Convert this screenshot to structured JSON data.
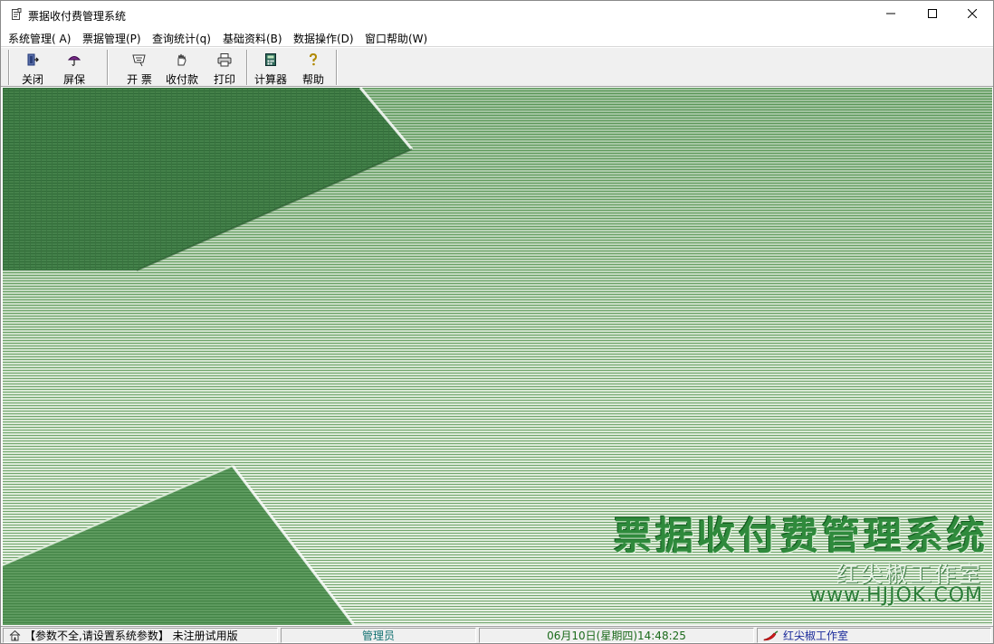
{
  "window": {
    "title": "票据收付费管理系统",
    "icons": {
      "app": "document-icon",
      "minimize": "minimize-icon",
      "maximize": "maximize-icon",
      "close": "close-icon"
    }
  },
  "menu": [
    {
      "label": "系统管理( A)"
    },
    {
      "label": "票据管理(P)"
    },
    {
      "label": "查询统计(q)"
    },
    {
      "label": "基础资料(B)"
    },
    {
      "label": "数据操作(D)"
    },
    {
      "label": "窗口帮助(W)"
    }
  ],
  "toolbar": {
    "close": {
      "label": "关闭",
      "icon": "exit-door-icon"
    },
    "screensaver": {
      "label": "屏保",
      "icon": "umbrella-icon"
    },
    "issue": {
      "label": "开 票",
      "icon": "invoice-icon"
    },
    "payment": {
      "label": "收付款",
      "icon": "hand-money-icon"
    },
    "print": {
      "label": "打印",
      "icon": "printer-icon"
    },
    "calculator": {
      "label": "计算器",
      "icon": "calculator-icon"
    },
    "help": {
      "label": "帮助",
      "icon": "help-icon"
    }
  },
  "splash": {
    "title": "票据收付费管理系统",
    "studio": "红尖椒工作室",
    "url": "www.HJJOK.COM",
    "colors": {
      "accent": "#2f8a3c",
      "background": "#a9cba4"
    }
  },
  "statusbar": {
    "notice": "【参数不全,请设置系统参数】 未注册试用版",
    "user": "管理员",
    "datetime": "06月10日(星期四)14:48:25",
    "studio": "红尖椒工作室",
    "icons": {
      "home": "home-icon",
      "pepper": "chili-pepper-icon"
    }
  }
}
